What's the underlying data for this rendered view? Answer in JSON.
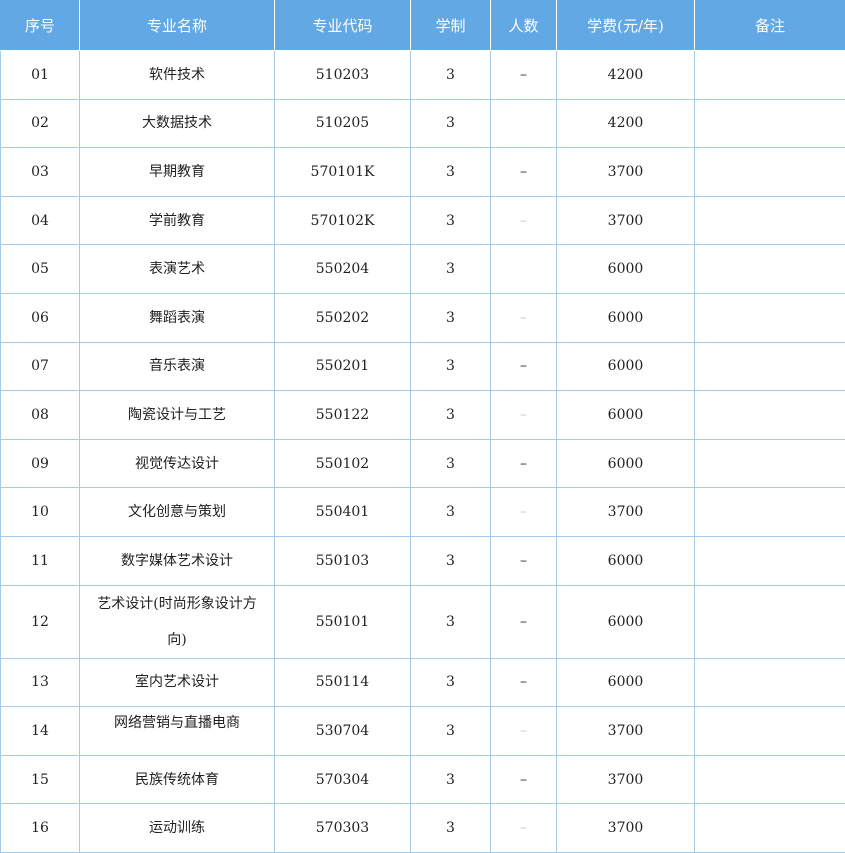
{
  "headers": [
    "序号",
    "专业名称",
    "专业代码",
    "学制",
    "人数",
    "学费(元/年)",
    "备注"
  ],
  "rows": [
    {
      "no": "01",
      "name": "软件技术",
      "code": "510203",
      "years": "3",
      "count": "–",
      "count_style": "dash",
      "fee": "4200",
      "note": ""
    },
    {
      "no": "02",
      "name": "大数据技术",
      "code": "510205",
      "years": "3",
      "count": "",
      "count_style": "empty",
      "fee": "4200",
      "note": ""
    },
    {
      "no": "03",
      "name": "早期教育",
      "code": "570101K",
      "years": "3",
      "count": "–",
      "count_style": "dash",
      "fee": "3700",
      "note": ""
    },
    {
      "no": "04",
      "name": "学前教育",
      "code": "570102K",
      "years": "3",
      "count": "–",
      "count_style": "faint",
      "fee": "3700",
      "note": ""
    },
    {
      "no": "05",
      "name": "表演艺术",
      "code": "550204",
      "years": "3",
      "count": "",
      "count_style": "empty",
      "fee": "6000",
      "note": ""
    },
    {
      "no": "06",
      "name": "舞蹈表演",
      "code": "550202",
      "years": "3",
      "count": "–",
      "count_style": "faint",
      "fee": "6000",
      "note": ""
    },
    {
      "no": "07",
      "name": "音乐表演",
      "code": "550201",
      "years": "3",
      "count": "–",
      "count_style": "dash",
      "fee": "6000",
      "note": ""
    },
    {
      "no": "08",
      "name": "陶瓷设计与工艺",
      "code": "550122",
      "years": "3",
      "count": "–",
      "count_style": "faint",
      "fee": "6000",
      "note": ""
    },
    {
      "no": "09",
      "name": "视觉传达设计",
      "code": "550102",
      "years": "3",
      "count": "–",
      "count_style": "dash",
      "fee": "6000",
      "note": ""
    },
    {
      "no": "10",
      "name": "文化创意与策划",
      "code": "550401",
      "years": "3",
      "count": "–",
      "count_style": "faint",
      "fee": "3700",
      "note": ""
    },
    {
      "no": "11",
      "name": "数字媒体艺术设计",
      "code": "550103",
      "years": "3",
      "count": "–",
      "count_style": "dash",
      "fee": "6000",
      "note": ""
    },
    {
      "no": "12",
      "name": "艺术设计(时尚形象设计方向)",
      "code": "550101",
      "years": "3",
      "count": "–",
      "count_style": "dash",
      "fee": "6000",
      "note": "",
      "tall": true
    },
    {
      "no": "13",
      "name": "室内艺术设计",
      "code": "550114",
      "years": "3",
      "count": "–",
      "count_style": "dash",
      "fee": "6000",
      "note": ""
    },
    {
      "no": "14",
      "name": "网络营销与直播电商",
      "code": "530704",
      "years": "3",
      "count": "–",
      "count_style": "faint",
      "fee": "3700",
      "note": "",
      "clip": true
    },
    {
      "no": "15",
      "name": "民族传统体育",
      "code": "570304",
      "years": "3",
      "count": "–",
      "count_style": "dash",
      "fee": "3700",
      "note": ""
    },
    {
      "no": "16",
      "name": "运动训练",
      "code": "570303",
      "years": "3",
      "count": "–",
      "count_style": "faint",
      "fee": "3700",
      "note": ""
    }
  ],
  "colors": {
    "header_bg": "#62a8e4",
    "border": "#a6cbe8"
  }
}
